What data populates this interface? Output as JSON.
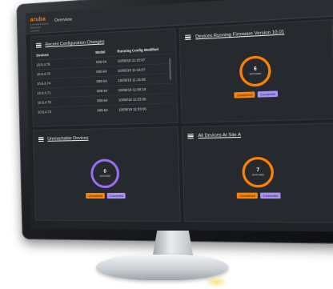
{
  "header": {
    "logo_text": "aruba",
    "logo_subtext": "a Hewlett Packard Enterprise company",
    "page_title": "Overview"
  },
  "panels": {
    "config_changes": {
      "title": "Recent Configuration Changes",
      "columns": [
        "Devices",
        "Model",
        "Running Config Modified"
      ],
      "rows": [
        [
          "10.6.4.76",
          "X86-64",
          "10/08/18 11:15:07"
        ],
        [
          "10.6.4.75",
          "X86-64",
          "10/08/18 11:15:07"
        ],
        [
          "10.6.4.74",
          "X86-64",
          "10/08/18 11:15:06"
        ],
        [
          "10.6.4.71",
          "X86-64",
          "10/08/18 11:08:19"
        ],
        [
          "10.6.4.70",
          "X86-64",
          "10/08/18 11:03:06"
        ],
        [
          "10.6.4.73",
          "X86-64",
          "10/08/18 11:03:06"
        ]
      ]
    },
    "firmware": {
      "title": "Devices Running Firmware Version 10.01",
      "count": "6",
      "matched_label": "MATCHED",
      "tag_unmatched": "Unmatched",
      "tag_connected": "Connected",
      "ring_color": "#ff8300"
    },
    "unreachable": {
      "title": "Unreachable Devices",
      "count": "0",
      "matched_label": "MATCHED",
      "tag_unmatched": "Unmatched",
      "tag_connected": "Connected",
      "ring_color": "#9b6ef3"
    },
    "site_a": {
      "title": "All Devices At Site A",
      "count": "7",
      "matched_label": "MATCHED",
      "tag_unmatched": "Unmatched",
      "tag_connected": "Connected",
      "ring_color": "#ff8300"
    }
  },
  "colors": {
    "accent_orange": "#ff8300",
    "accent_purple": "#9b6ef3",
    "panel_bg": "#26292d"
  }
}
